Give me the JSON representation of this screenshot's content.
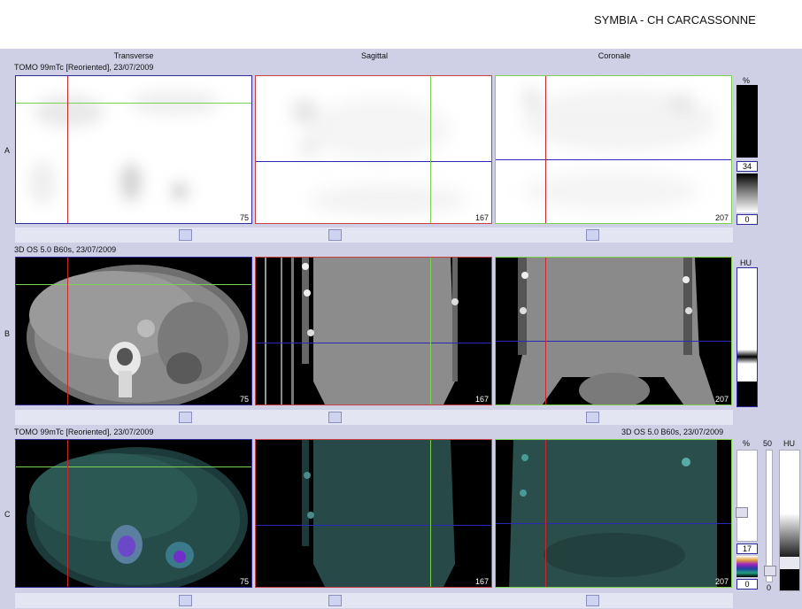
{
  "header": {
    "title": "SYMBIA - CH CARCASSONNE"
  },
  "columns": {
    "transverse": "Transverse",
    "sagittal": "Sagittal",
    "coronal": "Coronale"
  },
  "rows": {
    "a": {
      "label": "A",
      "series": "TOMO 99mTc [Reoriented], 23/07/2009"
    },
    "b": {
      "label": "B",
      "series": "3D  OS  5.0  B60s, 23/07/2009"
    },
    "c": {
      "label": "C",
      "series": "TOMO 99mTc [Reoriented], 23/07/2009",
      "series_right": "3D  OS  5.0  B60s, 23/07/2009"
    }
  },
  "slices": {
    "transverse": "75",
    "sagittal": "167",
    "coronal": "207"
  },
  "scales": {
    "a": {
      "unit": "%",
      "max": "34",
      "min": "0"
    },
    "b": {
      "unit": "HU"
    },
    "c": {
      "unit": "%",
      "max": "17",
      "min": "0",
      "window": "50",
      "zero": "0",
      "unit2": "HU"
    }
  },
  "colors": {
    "crosshair_green": "#7ed150",
    "crosshair_red": "#c8282c",
    "crosshair_blue": "#2a2ab8",
    "workspace": "#cfd0e6"
  }
}
